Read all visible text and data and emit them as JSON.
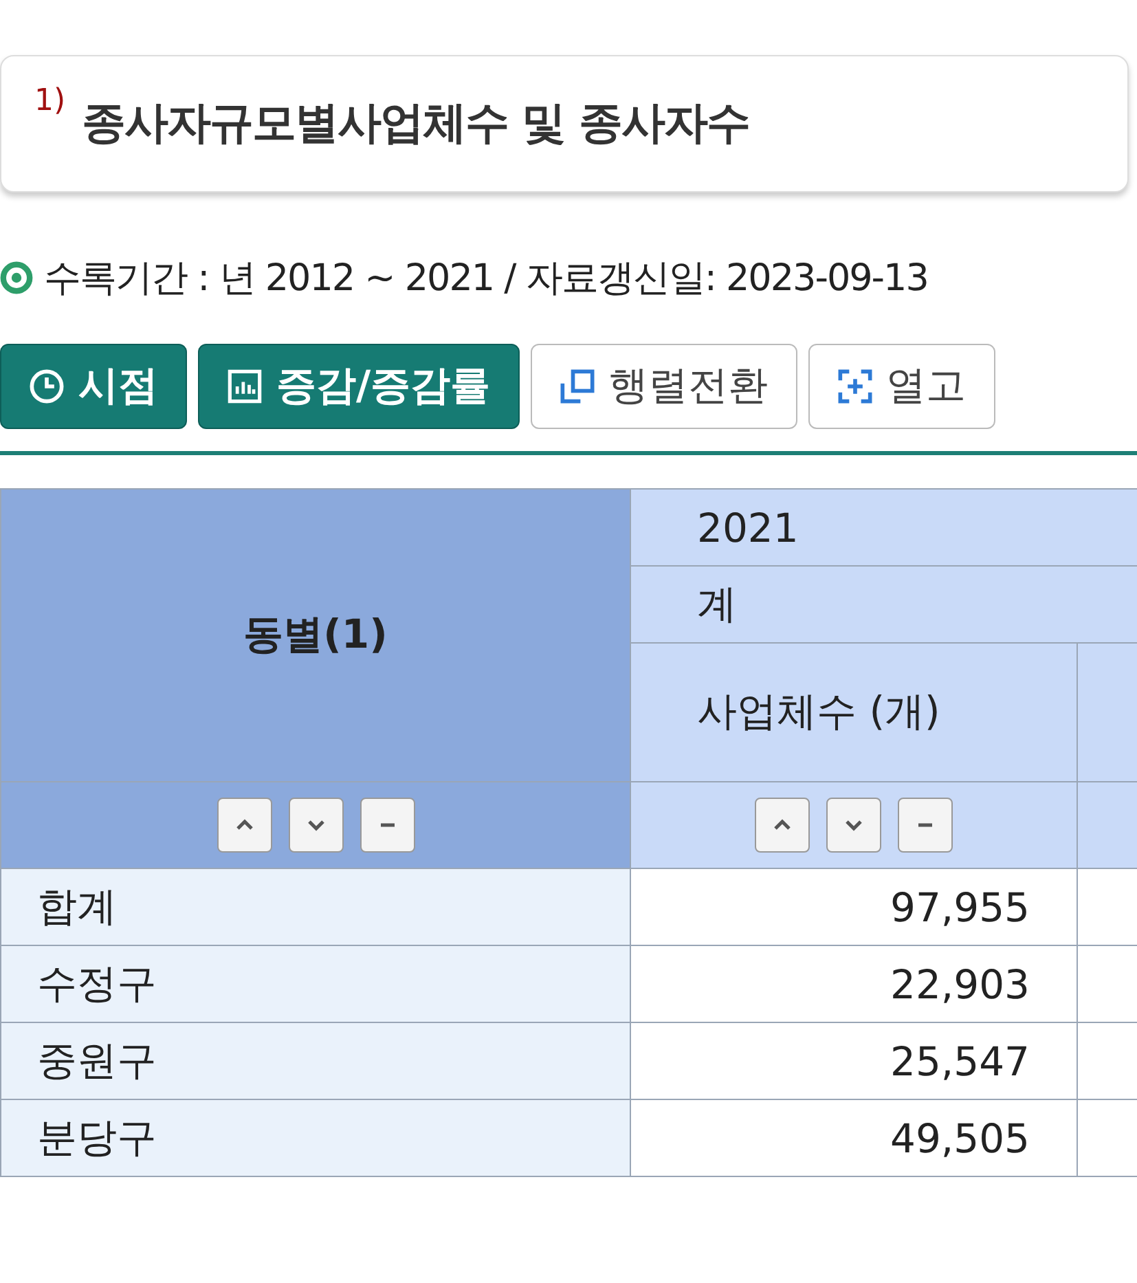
{
  "title": {
    "note": "1)",
    "text": "종사자규모별사업체수 및 종사자수"
  },
  "period": "수록기간 : 년 2012 ~ 2021 / 자료갱신일: 2023-09-13",
  "toolbar": [
    {
      "label": "시점",
      "kind": "primary"
    },
    {
      "label": "증감/증감률",
      "kind": "primary"
    },
    {
      "label": "행렬전환",
      "kind": "secondary"
    },
    {
      "label": "열고",
      "kind": "secondary"
    }
  ],
  "table": {
    "row_header": "동별(1)",
    "year": "2021",
    "group": "계",
    "columns": [
      "사업체수 (개)"
    ],
    "rows": [
      {
        "name": "합계",
        "values": [
          "97,955"
        ]
      },
      {
        "name": "수정구",
        "values": [
          "22,903"
        ]
      },
      {
        "name": "중원구",
        "values": [
          "25,547"
        ]
      },
      {
        "name": "분당구",
        "values": [
          "49,505"
        ]
      }
    ]
  }
}
